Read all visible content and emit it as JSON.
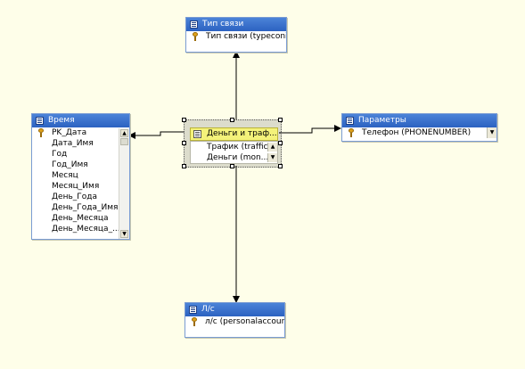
{
  "colors": {
    "canvas": "#fefee9",
    "table_header": "#3a72cf",
    "fact_header": "#f4f27a",
    "key": "#e0a21a"
  },
  "tables": {
    "tip_svyazi": {
      "title": "Тип связи",
      "columns": [
        {
          "label": "Тип связи (typeconid)",
          "key": true
        }
      ]
    },
    "vremya": {
      "title": "Время",
      "columns": [
        {
          "label": "PK_Дата",
          "key": true
        },
        {
          "label": "Дата_Имя",
          "key": false
        },
        {
          "label": "Год",
          "key": false
        },
        {
          "label": "Год_Имя",
          "key": false
        },
        {
          "label": "Месяц",
          "key": false
        },
        {
          "label": "Месяц_Имя",
          "key": false
        },
        {
          "label": "День_Года",
          "key": false
        },
        {
          "label": "День_Года_Имя",
          "key": false
        },
        {
          "label": "День_Месяца",
          "key": false
        },
        {
          "label": "День_Месяца_...",
          "key": false
        }
      ]
    },
    "fact": {
      "title": "Деньги и траф...",
      "columns": [
        {
          "label": "Трафик (traffic)"
        },
        {
          "label": "Деньги (mon..."
        }
      ]
    },
    "parametry": {
      "title": "Параметры",
      "columns": [
        {
          "label": "Телефон (PHONENUMBER)",
          "key": true
        }
      ]
    },
    "ls": {
      "title": "Л/с",
      "columns": [
        {
          "label": "л/с (personalaccount)",
          "key": true
        }
      ]
    }
  }
}
